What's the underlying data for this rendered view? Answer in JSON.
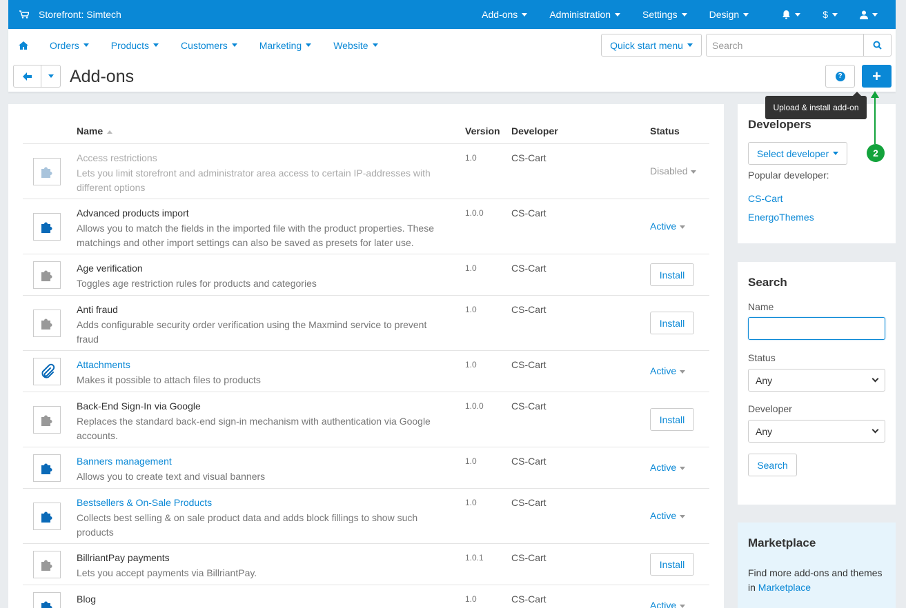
{
  "topbar": {
    "store_title": "Storefront: Simtech",
    "menu": [
      "Add-ons",
      "Administration",
      "Settings",
      "Design"
    ],
    "currency": "$"
  },
  "nav": {
    "items": [
      "Orders",
      "Products",
      "Customers",
      "Marketing",
      "Website"
    ],
    "quick_start": "Quick start menu",
    "search_placeholder": "Search"
  },
  "page": {
    "title": "Add-ons",
    "tooltip": "Upload & install add-on",
    "callout_number": "2"
  },
  "table": {
    "headers": {
      "name": "Name",
      "version": "Version",
      "developer": "Developer",
      "status": "Status"
    },
    "rows": [
      {
        "name": "Access restrictions",
        "desc": "Lets you limit storefront and administrator area access to certain IP-addresses with different options",
        "version": "1.0",
        "developer": "CS-Cart",
        "status": "Disabled"
      },
      {
        "name": "Advanced products import",
        "desc": "Allows you to match the fields in the imported file with the product properties. These matchings and other import settings can also be saved as presets for later use.",
        "version": "1.0.0",
        "developer": "CS-Cart",
        "status": "Active"
      },
      {
        "name": "Age verification",
        "desc": "Toggles age restriction rules for products and categories",
        "version": "1.0",
        "developer": "CS-Cart",
        "status": "Install"
      },
      {
        "name": "Anti fraud",
        "desc": "Adds configurable security order verification using the Maxmind service to prevent fraud",
        "version": "1.0",
        "developer": "CS-Cart",
        "status": "Install"
      },
      {
        "name": "Attachments",
        "desc": "Makes it possible to attach files to products",
        "version": "1.0",
        "developer": "CS-Cart",
        "status": "Active"
      },
      {
        "name": "Back-End Sign-In via Google",
        "desc": "Replaces the standard back-end sign-in mechanism with authentication via Google accounts.",
        "version": "1.0.0",
        "developer": "CS-Cart",
        "status": "Install"
      },
      {
        "name": "Banners management",
        "desc": "Allows you to create text and visual banners",
        "version": "1.0",
        "developer": "CS-Cart",
        "status": "Active"
      },
      {
        "name": "Bestsellers & On-Sale Products",
        "desc": "Collects best selling & on sale product data and adds block fillings to show such products",
        "version": "1.0",
        "developer": "CS-Cart",
        "status": "Active"
      },
      {
        "name": "BillriantPay payments",
        "desc": "Lets you accept payments via BillriantPay.",
        "version": "1.0.1",
        "developer": "CS-Cart",
        "status": "Install"
      },
      {
        "name": "Blog",
        "desc": "",
        "version": "1.0",
        "developer": "CS-Cart",
        "status": "Active"
      }
    ]
  },
  "developers": {
    "title": "Developers",
    "select_label": "Select developer",
    "popular_label": "Popular developer:",
    "links": [
      "CS-Cart",
      "EnergoThemes"
    ]
  },
  "search_panel": {
    "title": "Search",
    "name_label": "Name",
    "name_value": "",
    "status_label": "Status",
    "status_value": "Any",
    "developer_label": "Developer",
    "developer_value": "Any",
    "button": "Search"
  },
  "marketplace": {
    "title": "Marketplace",
    "text": "Find more add-ons and themes in ",
    "link": "Marketplace"
  },
  "colors": {
    "accent": "#0a88d6",
    "callout": "#13a33c",
    "tooltip_bg": "#333333"
  }
}
